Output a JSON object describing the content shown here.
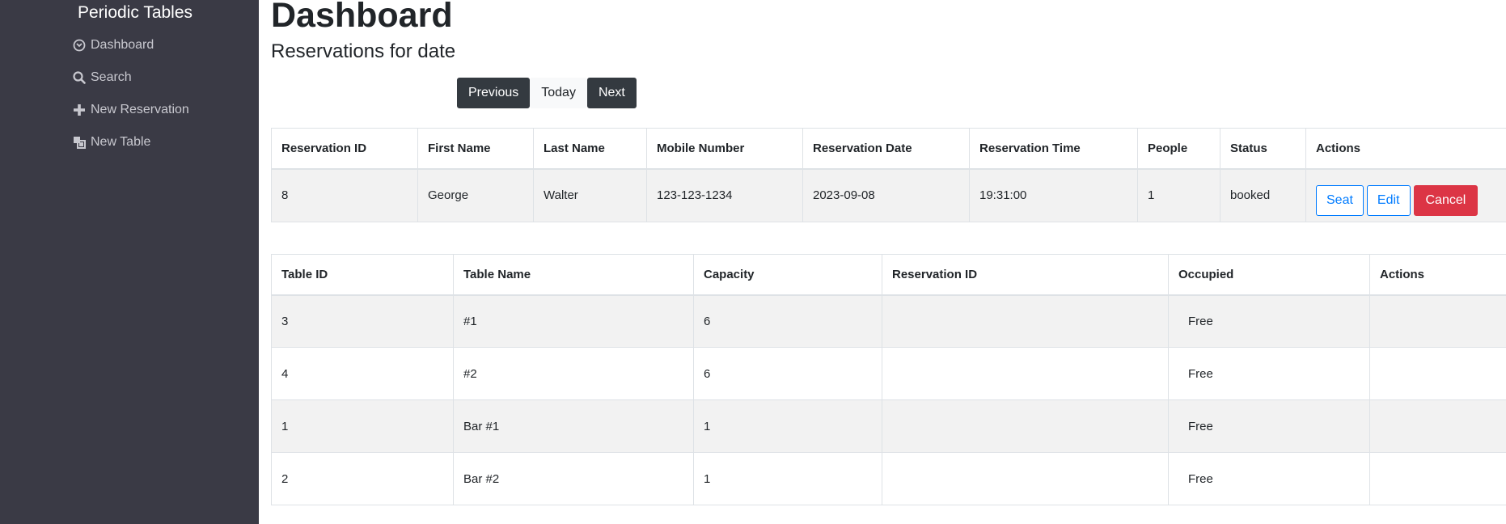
{
  "sidebar": {
    "brand": "Periodic Tables",
    "items": [
      {
        "label": "Dashboard",
        "icon": "dashboard-icon"
      },
      {
        "label": "Search",
        "icon": "search-icon"
      },
      {
        "label": "New Reservation",
        "icon": "plus-icon"
      },
      {
        "label": "New Table",
        "icon": "table-icon"
      }
    ]
  },
  "header": {
    "title": "Dashboard",
    "subtitle": "Reservations for date"
  },
  "date_nav": {
    "previous": "Previous",
    "today": "Today",
    "next": "Next"
  },
  "reservations": {
    "headers": [
      "Reservation ID",
      "First Name",
      "Last Name",
      "Mobile Number",
      "Reservation Date",
      "Reservation Time",
      "People",
      "Status",
      "Actions"
    ],
    "rows": [
      {
        "reservation_id": "8",
        "first_name": "George",
        "last_name": "Walter",
        "mobile_number": "123-123-1234",
        "reservation_date": "2023-09-08",
        "reservation_time": "19:31:00",
        "people": "1",
        "status": "booked",
        "actions": {
          "seat": "Seat",
          "edit": "Edit",
          "cancel": "Cancel"
        }
      }
    ]
  },
  "tables": {
    "headers": [
      "Table ID",
      "Table Name",
      "Capacity",
      "Reservation ID",
      "Occupied",
      "Actions"
    ],
    "rows": [
      {
        "table_id": "3",
        "table_name": "#1",
        "capacity": "6",
        "reservation_id": "",
        "occupied": "Free"
      },
      {
        "table_id": "4",
        "table_name": "#2",
        "capacity": "6",
        "reservation_id": "",
        "occupied": "Free"
      },
      {
        "table_id": "1",
        "table_name": "Bar #1",
        "capacity": "1",
        "reservation_id": "",
        "occupied": "Free"
      },
      {
        "table_id": "2",
        "table_name": "Bar #2",
        "capacity": "1",
        "reservation_id": "",
        "occupied": "Free"
      }
    ]
  },
  "colors": {
    "sidebar_bg": "#3a3a45",
    "dark_button": "#343a40",
    "primary": "#007bff",
    "danger": "#dc3545",
    "stripe": "#f2f2f2"
  }
}
